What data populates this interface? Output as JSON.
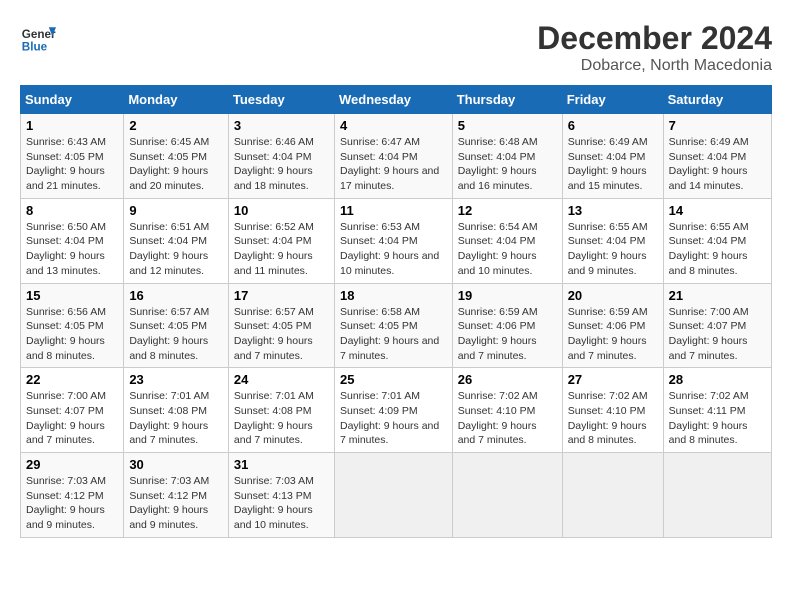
{
  "header": {
    "logo_line1": "General",
    "logo_line2": "Blue",
    "title": "December 2024",
    "subtitle": "Dobarce, North Macedonia"
  },
  "calendar": {
    "days_of_week": [
      "Sunday",
      "Monday",
      "Tuesday",
      "Wednesday",
      "Thursday",
      "Friday",
      "Saturday"
    ],
    "weeks": [
      [
        {
          "day": "1",
          "sunrise": "6:43 AM",
          "sunset": "4:05 PM",
          "daylight": "9 hours and 21 minutes."
        },
        {
          "day": "2",
          "sunrise": "6:45 AM",
          "sunset": "4:05 PM",
          "daylight": "9 hours and 20 minutes."
        },
        {
          "day": "3",
          "sunrise": "6:46 AM",
          "sunset": "4:04 PM",
          "daylight": "9 hours and 18 minutes."
        },
        {
          "day": "4",
          "sunrise": "6:47 AM",
          "sunset": "4:04 PM",
          "daylight": "9 hours and 17 minutes."
        },
        {
          "day": "5",
          "sunrise": "6:48 AM",
          "sunset": "4:04 PM",
          "daylight": "9 hours and 16 minutes."
        },
        {
          "day": "6",
          "sunrise": "6:49 AM",
          "sunset": "4:04 PM",
          "daylight": "9 hours and 15 minutes."
        },
        {
          "day": "7",
          "sunrise": "6:49 AM",
          "sunset": "4:04 PM",
          "daylight": "9 hours and 14 minutes."
        }
      ],
      [
        {
          "day": "8",
          "sunrise": "6:50 AM",
          "sunset": "4:04 PM",
          "daylight": "9 hours and 13 minutes."
        },
        {
          "day": "9",
          "sunrise": "6:51 AM",
          "sunset": "4:04 PM",
          "daylight": "9 hours and 12 minutes."
        },
        {
          "day": "10",
          "sunrise": "6:52 AM",
          "sunset": "4:04 PM",
          "daylight": "9 hours and 11 minutes."
        },
        {
          "day": "11",
          "sunrise": "6:53 AM",
          "sunset": "4:04 PM",
          "daylight": "9 hours and 10 minutes."
        },
        {
          "day": "12",
          "sunrise": "6:54 AM",
          "sunset": "4:04 PM",
          "daylight": "9 hours and 10 minutes."
        },
        {
          "day": "13",
          "sunrise": "6:55 AM",
          "sunset": "4:04 PM",
          "daylight": "9 hours and 9 minutes."
        },
        {
          "day": "14",
          "sunrise": "6:55 AM",
          "sunset": "4:04 PM",
          "daylight": "9 hours and 8 minutes."
        }
      ],
      [
        {
          "day": "15",
          "sunrise": "6:56 AM",
          "sunset": "4:05 PM",
          "daylight": "9 hours and 8 minutes."
        },
        {
          "day": "16",
          "sunrise": "6:57 AM",
          "sunset": "4:05 PM",
          "daylight": "9 hours and 8 minutes."
        },
        {
          "day": "17",
          "sunrise": "6:57 AM",
          "sunset": "4:05 PM",
          "daylight": "9 hours and 7 minutes."
        },
        {
          "day": "18",
          "sunrise": "6:58 AM",
          "sunset": "4:05 PM",
          "daylight": "9 hours and 7 minutes."
        },
        {
          "day": "19",
          "sunrise": "6:59 AM",
          "sunset": "4:06 PM",
          "daylight": "9 hours and 7 minutes."
        },
        {
          "day": "20",
          "sunrise": "6:59 AM",
          "sunset": "4:06 PM",
          "daylight": "9 hours and 7 minutes."
        },
        {
          "day": "21",
          "sunrise": "7:00 AM",
          "sunset": "4:07 PM",
          "daylight": "9 hours and 7 minutes."
        }
      ],
      [
        {
          "day": "22",
          "sunrise": "7:00 AM",
          "sunset": "4:07 PM",
          "daylight": "9 hours and 7 minutes."
        },
        {
          "day": "23",
          "sunrise": "7:01 AM",
          "sunset": "4:08 PM",
          "daylight": "9 hours and 7 minutes."
        },
        {
          "day": "24",
          "sunrise": "7:01 AM",
          "sunset": "4:08 PM",
          "daylight": "9 hours and 7 minutes."
        },
        {
          "day": "25",
          "sunrise": "7:01 AM",
          "sunset": "4:09 PM",
          "daylight": "9 hours and 7 minutes."
        },
        {
          "day": "26",
          "sunrise": "7:02 AM",
          "sunset": "4:10 PM",
          "daylight": "9 hours and 7 minutes."
        },
        {
          "day": "27",
          "sunrise": "7:02 AM",
          "sunset": "4:10 PM",
          "daylight": "9 hours and 8 minutes."
        },
        {
          "day": "28",
          "sunrise": "7:02 AM",
          "sunset": "4:11 PM",
          "daylight": "9 hours and 8 minutes."
        }
      ],
      [
        {
          "day": "29",
          "sunrise": "7:03 AM",
          "sunset": "4:12 PM",
          "daylight": "9 hours and 9 minutes."
        },
        {
          "day": "30",
          "sunrise": "7:03 AM",
          "sunset": "4:12 PM",
          "daylight": "9 hours and 9 minutes."
        },
        {
          "day": "31",
          "sunrise": "7:03 AM",
          "sunset": "4:13 PM",
          "daylight": "9 hours and 10 minutes."
        },
        null,
        null,
        null,
        null
      ]
    ]
  }
}
